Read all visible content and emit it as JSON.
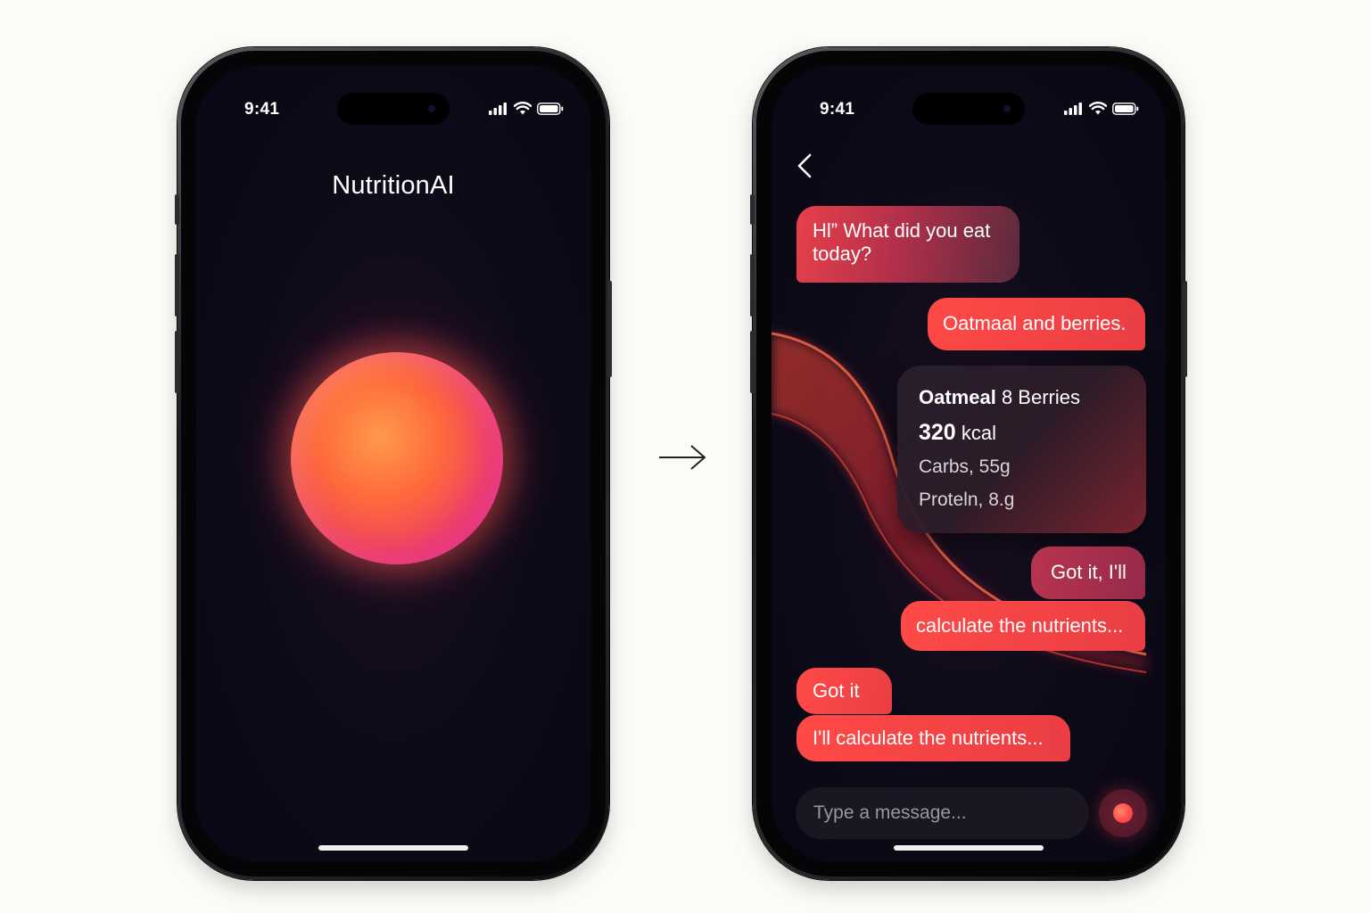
{
  "colors": {
    "background": "#fbfbf8",
    "screen": "#0d0a18",
    "accent": "#ff4a46",
    "orb_warm": "#ff9a4a",
    "orb_magenta": "#d63c8c"
  },
  "left_phone": {
    "status_time": "9:41",
    "app_title": "NutritionAI",
    "orb_icon": "glowing-orb"
  },
  "transition_icon": "right-arrow-icon",
  "right_phone": {
    "status_time": "9:41",
    "back_icon": "chevron-left-icon",
    "messages": [
      {
        "sender": "ai",
        "text": "Hl” What did you eat today?"
      },
      {
        "sender": "user",
        "text": "Oatmaal and berries."
      },
      {
        "sender": "user",
        "text": "Got it, I'll"
      },
      {
        "sender": "user",
        "text": "calculate the nutrients..."
      },
      {
        "sender": "ai",
        "text": "Got it"
      },
      {
        "sender": "ai",
        "text": "I'll calculate the nutrients..."
      }
    ],
    "nutrition_card": {
      "food_bold": "Oatmeal",
      "food_rest": " 8 Berries",
      "calories_value": "320",
      "calories_unit": " kcal",
      "carbs": "Carbs,  55g",
      "protein": "Proteln,  8.g"
    },
    "input": {
      "placeholder": "Type a message...",
      "value": ""
    },
    "send_icon": "record-dot-icon"
  }
}
